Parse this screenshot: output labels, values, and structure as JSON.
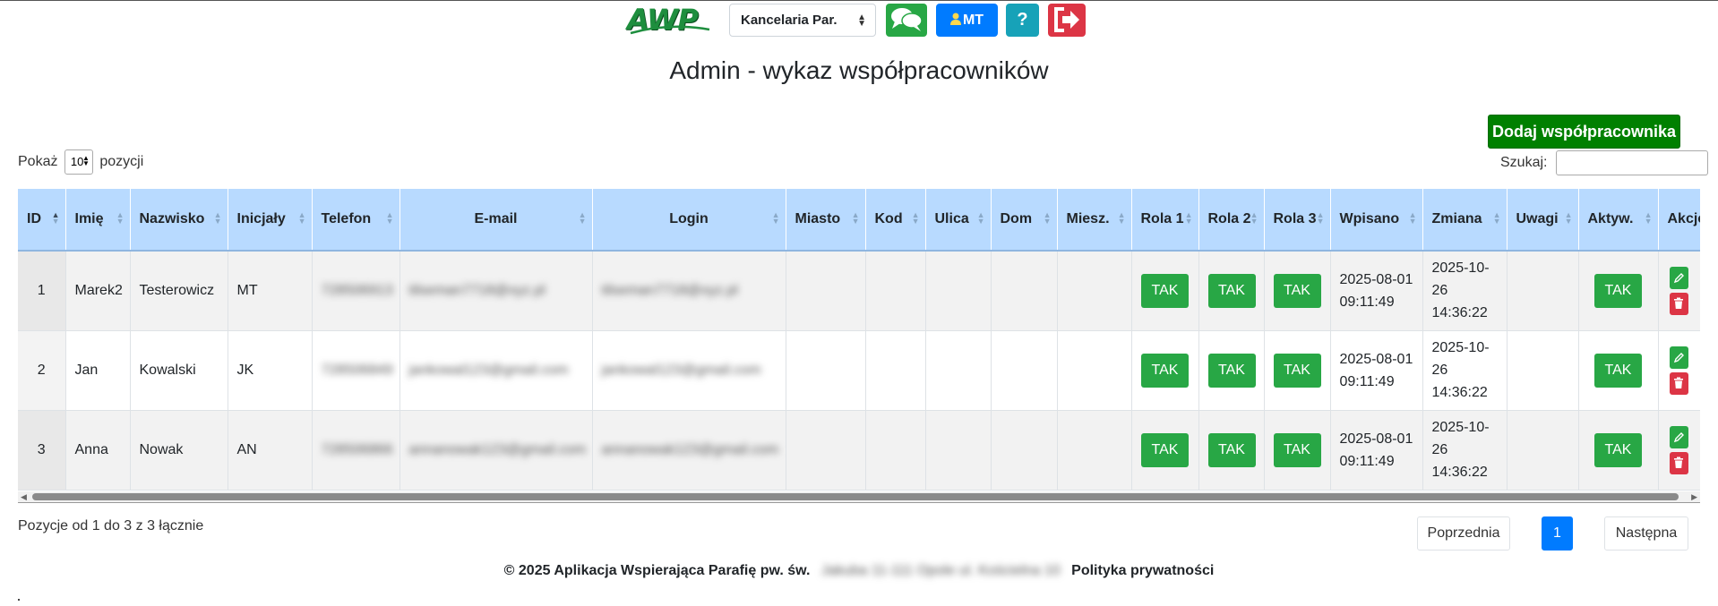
{
  "header": {
    "logo_text": "AWP",
    "org_select_value": "Kancelaria Par.",
    "user_button_label": "MT",
    "help_button_label": "?"
  },
  "page_title": "Admin - wykaz współpracowników",
  "add_button_label": "Dodaj współpracownika",
  "length": {
    "prefix": "Pokaż",
    "value": "10",
    "suffix": "pozycji"
  },
  "search": {
    "label": "Szukaj:",
    "value": ""
  },
  "table": {
    "columns": [
      "ID",
      "Imię",
      "Nazwisko",
      "Inicjały",
      "Telefon",
      "E-mail",
      "Login",
      "Miasto",
      "Kod",
      "Ulica",
      "Dom",
      "Miesz.",
      "Rola 1",
      "Rola 2",
      "Rola 3",
      "Wpisano",
      "Zmiana",
      "Uwagi",
      "Aktyw.",
      "Akcje"
    ],
    "rows": [
      {
        "id": "1",
        "imie": "Marek2",
        "nazwisko": "Testerowicz",
        "inicjaly": "MT",
        "telefon": "728506913",
        "email": "tilseman7718@xyz.pl",
        "login": "tilseman7718@xyz.pl",
        "miasto": "",
        "kod": "",
        "ulica": "",
        "dom": "",
        "miesz": "",
        "rola1": "TAK",
        "rola2": "TAK",
        "rola3": "TAK",
        "wpisano": "2025-08-01 09:11:49",
        "zmiana": "2025-10-26 14:36:22",
        "uwagi": "",
        "aktyw": "TAK"
      },
      {
        "id": "2",
        "imie": "Jan",
        "nazwisko": "Kowalski",
        "inicjaly": "JK",
        "telefon": "728506849",
        "email": "jankowal123@gmail.com",
        "login": "jankowal123@gmail.com",
        "miasto": "",
        "kod": "",
        "ulica": "",
        "dom": "",
        "miesz": "",
        "rola1": "TAK",
        "rola2": "TAK",
        "rola3": "TAK",
        "wpisano": "2025-08-01 09:11:49",
        "zmiana": "2025-10-26 14:36:22",
        "uwagi": "",
        "aktyw": "TAK"
      },
      {
        "id": "3",
        "imie": "Anna",
        "nazwisko": "Nowak",
        "inicjaly": "AN",
        "telefon": "728506866",
        "email": "annanowak123@gmail.com",
        "login": "annanowak123@gmail.com",
        "miasto": "",
        "kod": "",
        "ulica": "",
        "dom": "",
        "miesz": "",
        "rola1": "TAK",
        "rola2": "TAK",
        "rola3": "TAK",
        "wpisano": "2025-08-01 09:11:49",
        "zmiana": "2025-10-26 14:36:22",
        "uwagi": "",
        "aktyw": "TAK"
      }
    ]
  },
  "info_text": "Pozycje od 1 do 3 z 3 łącznie",
  "pagination": {
    "prev": "Poprzednia",
    "current": "1",
    "next": "Następna"
  },
  "footer": {
    "text": "© 2025 Aplikacja Wspierająca Parafię pw. św.",
    "blurred": "Jakuba 11-111 Opole ul. Kościelna 10",
    "privacy_link": "Polityka prywatności"
  },
  "colors": {
    "header_row": "#b8daff",
    "success": "#28a745",
    "add_button": "#008000",
    "primary": "#007bff",
    "info": "#17a2b8",
    "danger": "#dc3545"
  },
  "icons": [
    "chat-icon",
    "user-icon",
    "logout-icon",
    "edit-icon",
    "trash-icon",
    "sort-icon"
  ]
}
